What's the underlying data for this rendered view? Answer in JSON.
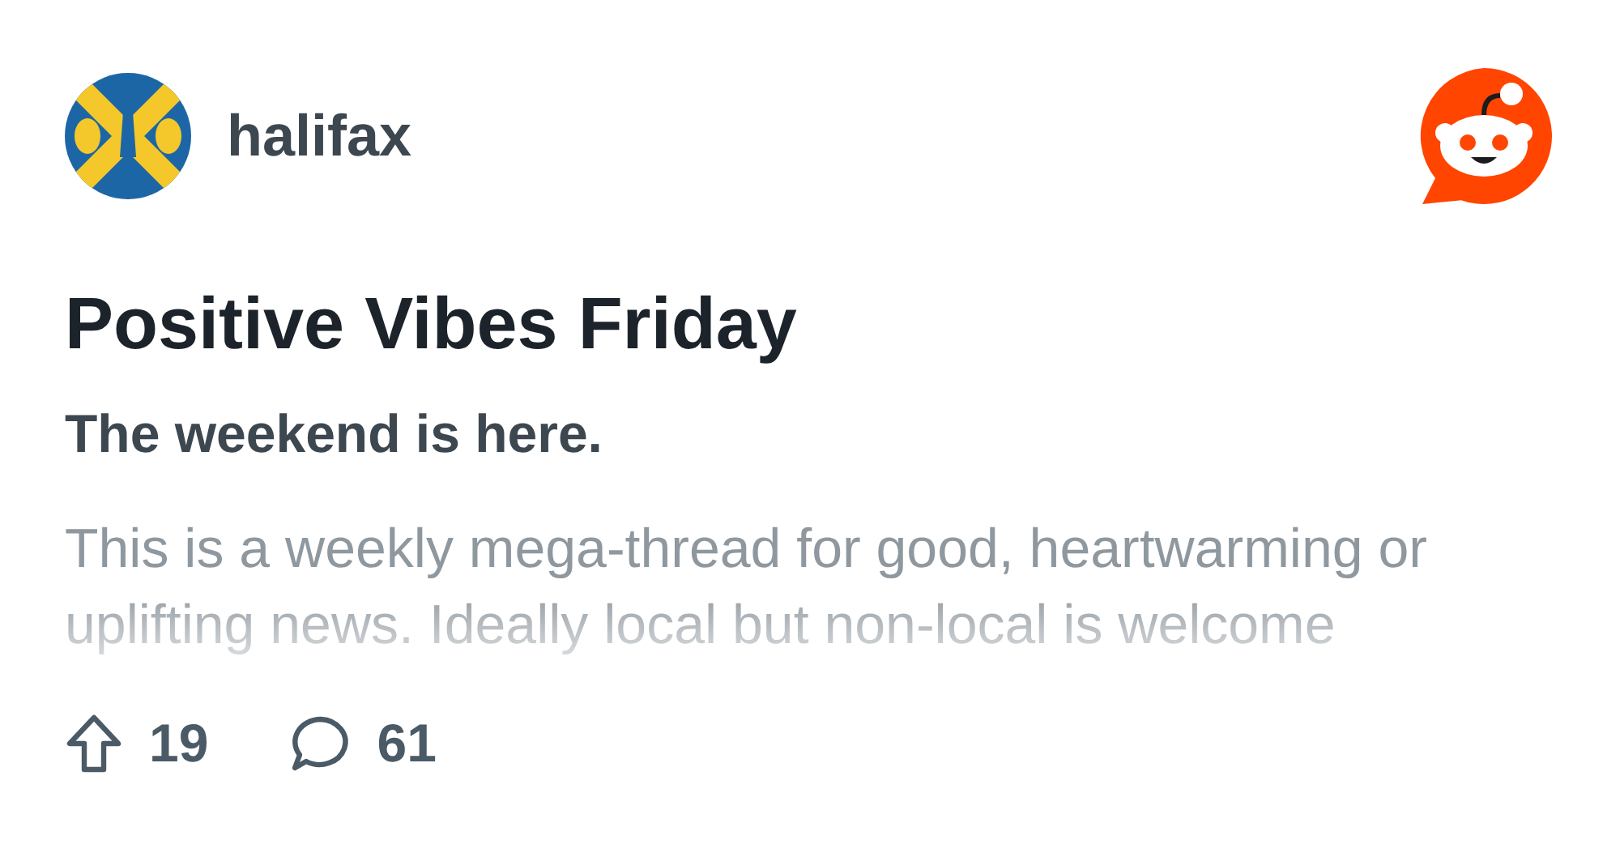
{
  "community": {
    "name": "halifax"
  },
  "post": {
    "title": "Positive Vibes Friday",
    "subtitle": "The weekend is here.",
    "body": "This is a weekly mega-thread for good, heartwarming or uplifting news. Ideally local but non-local is welcome"
  },
  "stats": {
    "upvotes": "19",
    "comments": "61"
  }
}
